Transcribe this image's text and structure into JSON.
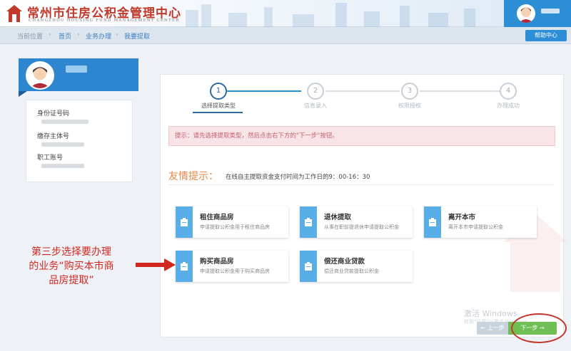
{
  "header": {
    "title": "常州市住房公积金管理中心",
    "subtitle": "CHANGZHOU HOUSING FUND MANAGEMENT CENTER",
    "brand_color": "#c0392b",
    "accent_color": "#2c8fd6"
  },
  "breadcrumb": {
    "prefix": "当前位置",
    "items": [
      "首页",
      "业务办理",
      "我要提取"
    ],
    "separator": "›"
  },
  "help_button": "帮助中心",
  "profile": {
    "fields": [
      {
        "label": "身份证号码"
      },
      {
        "label": "缴存主体号"
      },
      {
        "label": "职工账号"
      }
    ]
  },
  "steps": [
    {
      "num": "1",
      "label": "选择提取类型",
      "active": true
    },
    {
      "num": "2",
      "label": "信息录入",
      "active": false
    },
    {
      "num": "3",
      "label": "权限授权",
      "active": false
    },
    {
      "num": "4",
      "label": "办理成功",
      "active": false
    }
  ],
  "alert": "提示：请先选择提取类型，然后点击右下方的\"下一步\"按钮。",
  "tip": {
    "title": "友情提示：",
    "text": "在线自主提取资金支付时间为工作日的9：00-16：30"
  },
  "options": [
    {
      "title": "租住商品房",
      "desc": "申请提取公积金用于租住商品房",
      "icon": "document-icon"
    },
    {
      "title": "退休提取",
      "desc": "从事在职前提退休申请提取公积金",
      "icon": "document-icon"
    },
    {
      "title": "离开本市",
      "desc": "离开本市申请提取公积金",
      "icon": "document-icon"
    },
    {
      "title": "购买商品房",
      "desc": "申请提取公积金用于购买商品房",
      "icon": "document-icon"
    },
    {
      "title": "偿还商业贷款",
      "desc": "偿还商业贷款提取公积金",
      "icon": "document-icon"
    }
  ],
  "watermark": {
    "line1": "激活 Windows",
    "line2": "转到\"设置\"以激活 Windows。"
  },
  "pager": {
    "prev": "← 上一步",
    "next": "下一步 →"
  },
  "annotation": {
    "line1": "第三步选择要办理",
    "line2": "的业务“购买本市商",
    "line3": "品房提取”",
    "color": "#d0281f"
  }
}
